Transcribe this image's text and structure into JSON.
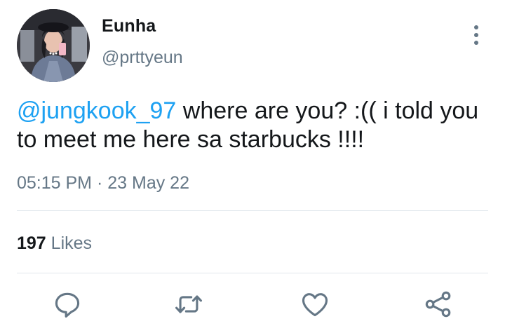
{
  "tweet": {
    "display_name": "Eunha",
    "handle": "@prttyeun",
    "mention": "@jungkook_97",
    "body": " where are you? :(( i told you to meet me here sa starbucks !!!!",
    "time": "05:15 PM",
    "separator": " · ",
    "date": "23 May 22",
    "likes_count": "197",
    "likes_label": " Likes"
  },
  "icons": {
    "more": "more-vertical-icon",
    "reply": "reply-icon",
    "retweet": "retweet-icon",
    "like": "heart-icon",
    "share": "share-icon"
  },
  "colors": {
    "accent": "#1da1f2",
    "text": "#14171a",
    "muted": "#657786",
    "divider": "#e1e8ed"
  }
}
